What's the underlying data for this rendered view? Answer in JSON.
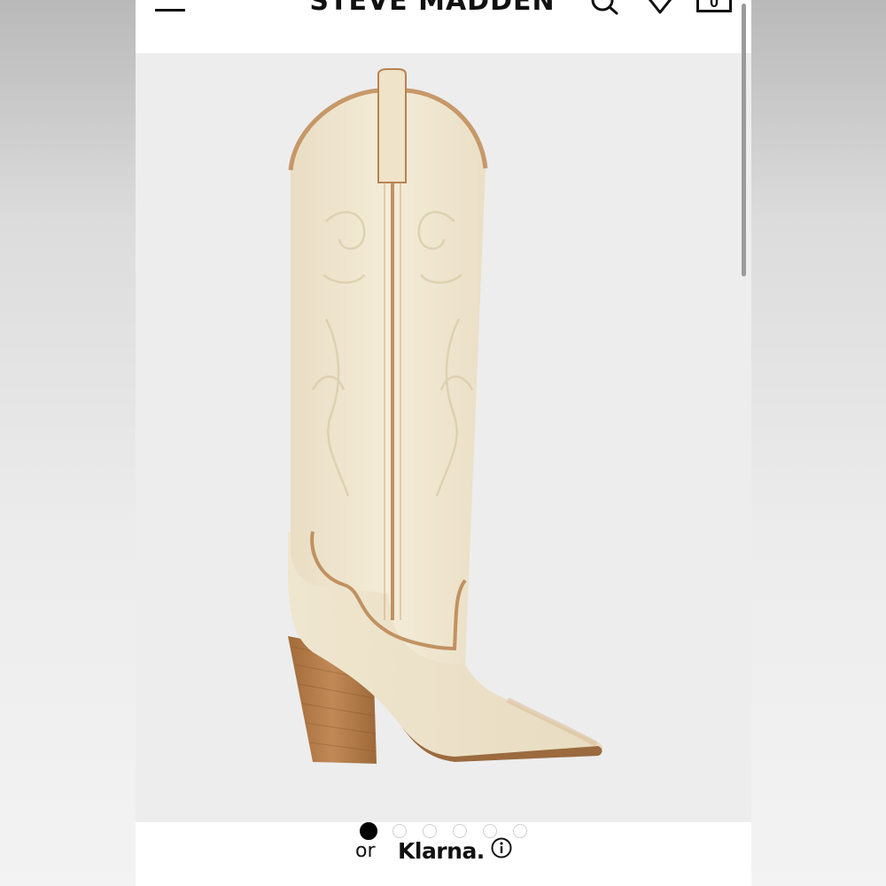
{
  "header": {
    "brand": "STEVE MADDEN",
    "bag_count": "0"
  },
  "icons": {
    "menu": "hamburger-menu-icon",
    "search": "search-icon",
    "wishlist": "heart-icon",
    "bag": "shopping-bag-icon",
    "info": "info-icon"
  },
  "gallery": {
    "image_count": 6,
    "active_index": 0
  },
  "payment": {
    "or": "or",
    "provider": "Klarna."
  },
  "colors": {
    "boot_body": "#efe6cf",
    "boot_trim": "#b9824f",
    "heel": "#b07a45",
    "background": "#ededed"
  }
}
